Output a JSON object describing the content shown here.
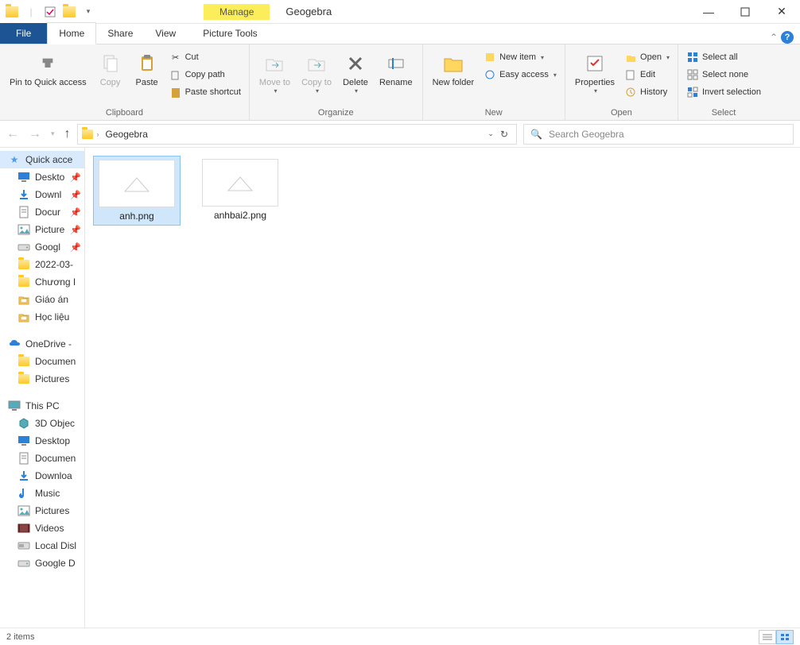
{
  "window": {
    "title": "Geogebra",
    "manage_label": "Manage"
  },
  "tabs": {
    "file": "File",
    "home": "Home",
    "share": "Share",
    "view": "View",
    "picture_tools": "Picture Tools"
  },
  "ribbon": {
    "clipboard": {
      "label": "Clipboard",
      "pin": "Pin to Quick access",
      "copy": "Copy",
      "paste": "Paste",
      "cut": "Cut",
      "copy_path": "Copy path",
      "paste_shortcut": "Paste shortcut"
    },
    "organize": {
      "label": "Organize",
      "move_to": "Move to",
      "copy_to": "Copy to",
      "delete": "Delete",
      "rename": "Rename"
    },
    "new": {
      "label": "New",
      "new_folder": "New folder",
      "new_item": "New item",
      "easy_access": "Easy access"
    },
    "open": {
      "label": "Open",
      "properties": "Properties",
      "open": "Open",
      "edit": "Edit",
      "history": "History"
    },
    "select": {
      "label": "Select",
      "select_all": "Select all",
      "select_none": "Select none",
      "invert": "Invert selection"
    }
  },
  "address": {
    "crumb": "Geogebra"
  },
  "search": {
    "placeholder": "Search Geogebra"
  },
  "sidebar": {
    "quick_access": "Quick acce",
    "quick_items": [
      {
        "label": "Deskto",
        "pinned": true,
        "icon": "desktop"
      },
      {
        "label": "Downl",
        "pinned": true,
        "icon": "download"
      },
      {
        "label": "Docur",
        "pinned": true,
        "icon": "document"
      },
      {
        "label": "Picture",
        "pinned": true,
        "icon": "pictures"
      },
      {
        "label": "Googl",
        "pinned": true,
        "icon": "drive"
      },
      {
        "label": "2022-03-",
        "pinned": false,
        "icon": "folder"
      },
      {
        "label": "Chương I",
        "pinned": false,
        "icon": "folder"
      },
      {
        "label": "Giáo án",
        "pinned": false,
        "icon": "folder-alt"
      },
      {
        "label": "Học liệu",
        "pinned": false,
        "icon": "folder-alt"
      }
    ],
    "onedrive": "OneDrive -",
    "onedrive_items": [
      {
        "label": "Documen",
        "icon": "folder"
      },
      {
        "label": "Pictures",
        "icon": "folder"
      }
    ],
    "this_pc": "This PC",
    "pc_items": [
      {
        "label": "3D Objec",
        "icon": "3d"
      },
      {
        "label": "Desktop",
        "icon": "desktop"
      },
      {
        "label": "Documen",
        "icon": "document"
      },
      {
        "label": "Downloa",
        "icon": "download"
      },
      {
        "label": "Music",
        "icon": "music"
      },
      {
        "label": "Pictures",
        "icon": "pictures"
      },
      {
        "label": "Videos",
        "icon": "videos"
      },
      {
        "label": "Local Disl",
        "icon": "disk"
      },
      {
        "label": "Google D",
        "icon": "drive"
      }
    ]
  },
  "files": [
    {
      "name": "anh.png",
      "selected": true
    },
    {
      "name": "anhbai2.png",
      "selected": false
    }
  ],
  "status": {
    "items": "2 items"
  }
}
